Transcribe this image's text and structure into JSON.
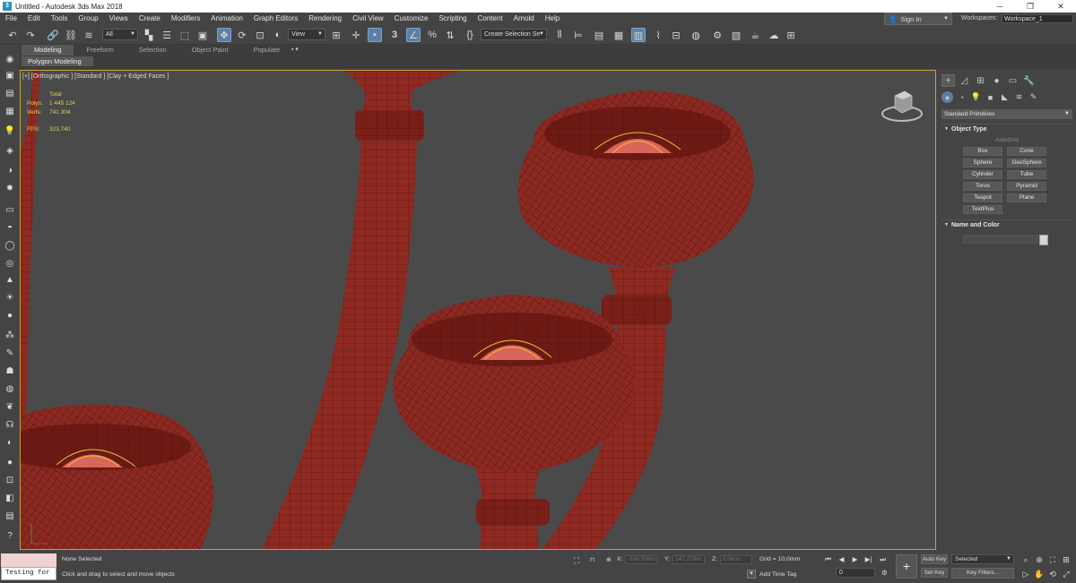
{
  "window": {
    "title": "Untitled - Autodesk 3ds Max 2018",
    "app_icon": "3",
    "buttons": [
      "─",
      "❐",
      "✕"
    ]
  },
  "menu": {
    "items": [
      "File",
      "Edit",
      "Tools",
      "Group",
      "Views",
      "Create",
      "Modifiers",
      "Animation",
      "Graph Editors",
      "Rendering",
      "Civil View",
      "Customize",
      "Scripting",
      "Content",
      "Arnold",
      "Help"
    ],
    "signin": "Sign In",
    "workspaces_label": "Workspaces:",
    "workspace_value": "Workspace_1"
  },
  "toolbar": {
    "filter_dropdown": "All",
    "refcoord_dropdown": "View",
    "angle_snap_label": "3",
    "named_selection_dropdown": "Create Selection Se"
  },
  "ribbon": {
    "tabs": [
      "Modeling",
      "Freeform",
      "Selection",
      "Object Paint",
      "Populate"
    ],
    "active_tab": "Modeling",
    "sub_label": "Polygon Modeling",
    "ctrl": "▪ ▾"
  },
  "viewport": {
    "label": "[+] [Orthographic ] [Standard ] [Clay + Edged Faces ]",
    "stats": {
      "total_label": "Total",
      "polys_label": "Polys:",
      "polys_value": "1 445 124",
      "verts_label": "Verts:",
      "verts_value": "741 304",
      "fps_label": "FPS:",
      "fps_value": "323,740"
    }
  },
  "command_panel": {
    "category_dropdown": "Standard Primitives",
    "object_type_title": "Object Type",
    "autogrid_label": "AutoGrid",
    "primitives": [
      "Box",
      "Cone",
      "Sphere",
      "GeoSphere",
      "Cylinder",
      "Tube",
      "Torus",
      "Pyramid",
      "Teapot",
      "Plane",
      "TextPlus"
    ],
    "name_color_title": "Name and Color"
  },
  "status": {
    "maxscript_input": "Testing for :",
    "selection": "None Selected",
    "prompt": "Click and drag to select and move objects",
    "x_label": "X:",
    "x_value": "-536,506m",
    "y_label": "Y:",
    "y_value": "147,278m",
    "z_label": "Z:",
    "z_value": "0,0mm",
    "grid": "Grid = 10,0mm",
    "add_time_tag": "Add Time Tag",
    "frame_value": "0",
    "auto_key": "Auto Key",
    "set_key": "Set Key",
    "key_mode_dropdown": "Selected",
    "key_filters": "Key Filters..."
  },
  "colors": {
    "accent_blue": "#5b7fa6",
    "viewport_border": "#c8a33c",
    "stats_yellow": "#e0d44a",
    "model_red": "#8e2a22"
  }
}
